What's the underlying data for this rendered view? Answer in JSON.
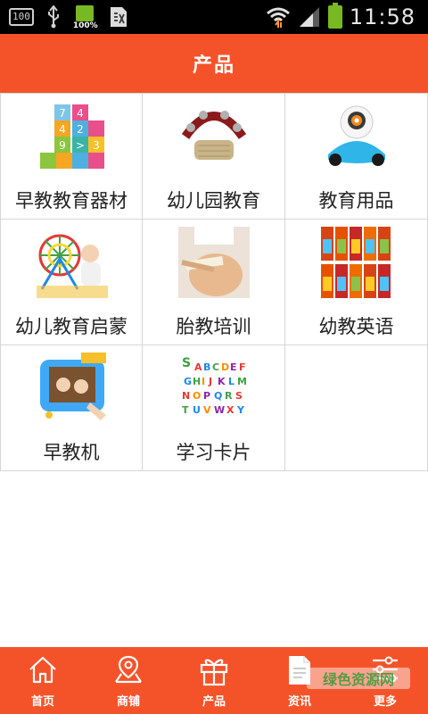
{
  "status_bar": {
    "notification_box": "100",
    "battery_small_pct": "100%",
    "time": "11:58"
  },
  "header": {
    "title": "产品"
  },
  "products": [
    {
      "label": "早教教育器材",
      "icon": "number-blocks-image"
    },
    {
      "label": "幼儿园教育",
      "icon": "tambourine-image"
    },
    {
      "label": "教育用品",
      "icon": "robot-toy-image"
    },
    {
      "label": "幼儿教育启蒙",
      "icon": "ferris-wheel-toy-image"
    },
    {
      "label": "胎教培训",
      "icon": "pregnant-belly-image"
    },
    {
      "label": "幼教英语",
      "icon": "book-set-image"
    },
    {
      "label": "早教机",
      "icon": "learning-tablet-image"
    },
    {
      "label": "学习卡片",
      "icon": "alphabet-cards-image"
    }
  ],
  "bottom_nav": [
    {
      "label": "首页",
      "icon": "home-icon"
    },
    {
      "label": "商铺",
      "icon": "map-pin-icon"
    },
    {
      "label": "产品",
      "icon": "gift-icon"
    },
    {
      "label": "资讯",
      "icon": "document-icon"
    },
    {
      "label": "更多",
      "icon": "sliders-icon"
    }
  ],
  "watermark": "绿色资源网",
  "colors": {
    "accent": "#f4532a",
    "status_bar": "#000000",
    "grid_line": "#d6d6d6"
  }
}
